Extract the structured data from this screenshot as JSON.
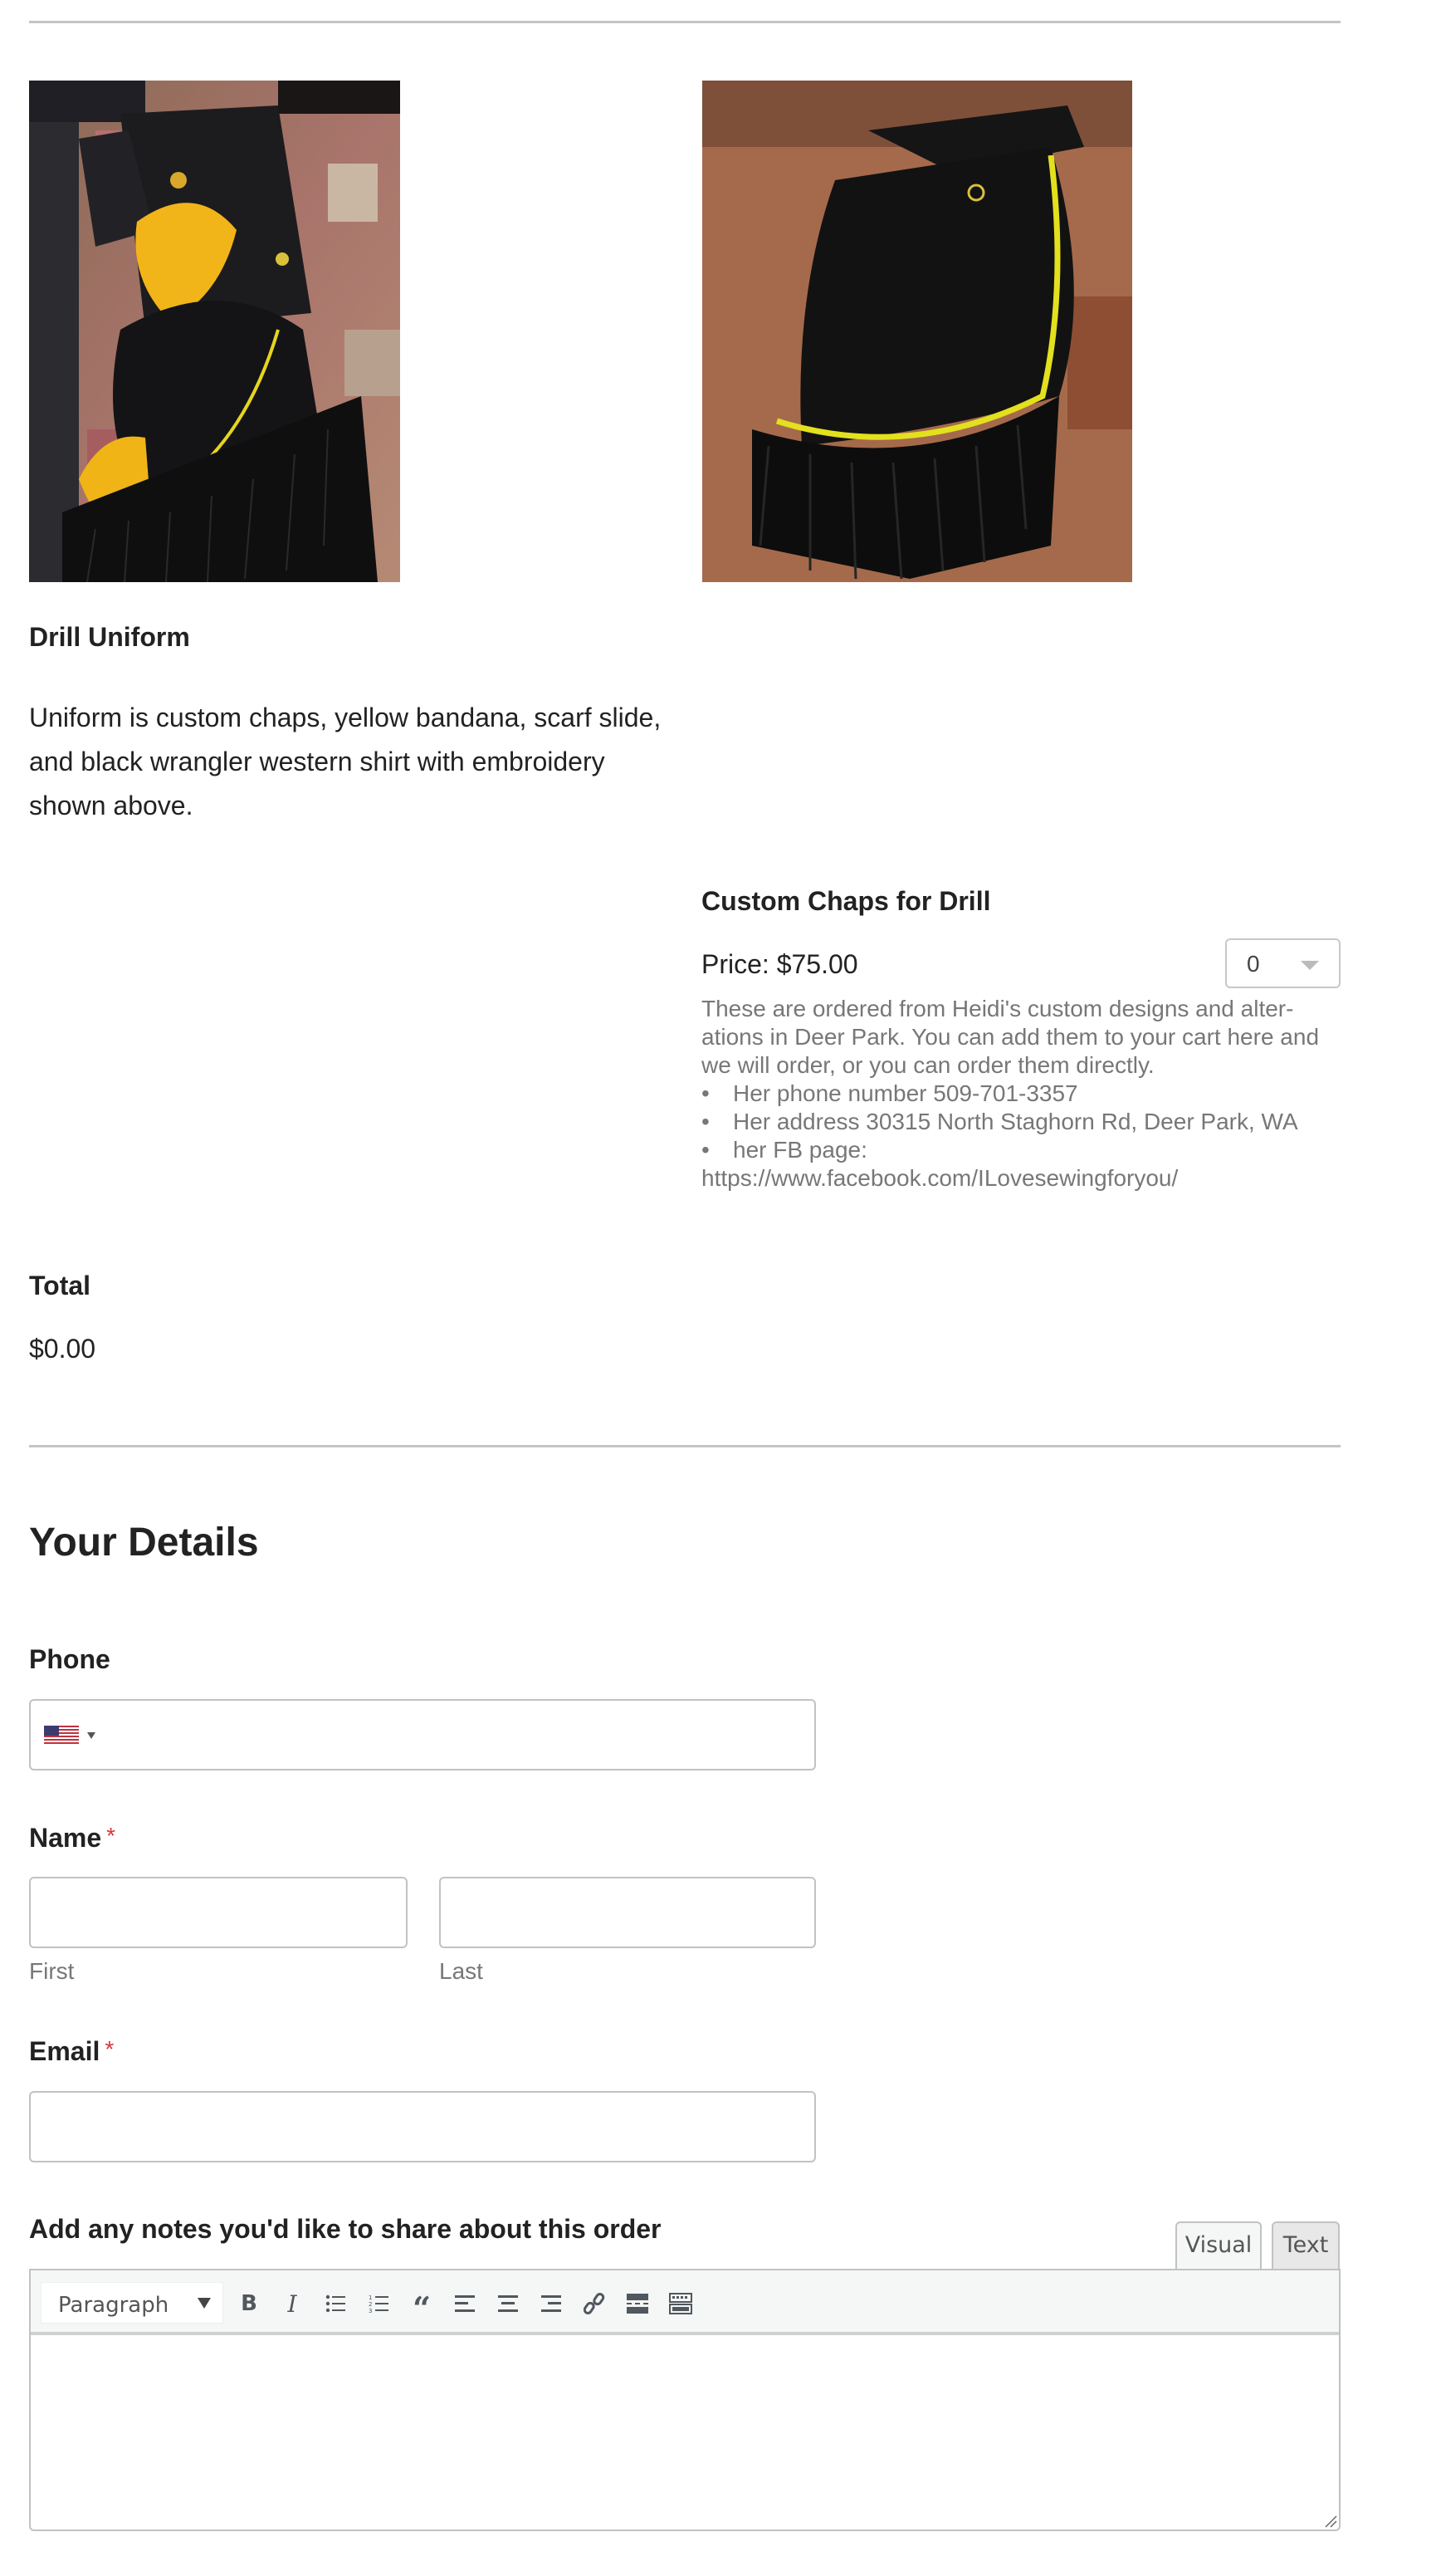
{
  "products": [
    {
      "title": "Drill Uniform",
      "image_alt": "Drill uniform: black western shirt, yellow bandana and black fringed chaps",
      "description": "Uniform is custom chaps, yellow bandana, scarf slide, and black wrangler western shirt with embroidery shown above."
    },
    {
      "title": "Custom Chaps for Drill",
      "image_alt": "Black fringed chaps with yellow piping",
      "price_label": "Price: $75.00",
      "quantity_selected": "0",
      "description": "These are ordered from Heidi's custom designs and alter-ations in Deer Park. You can add them to your cart here and we will order, or you can order them directly.",
      "bullets": [
        "Her phone number 509-701-3357",
        "Her address 30315 North Staghorn Rd, Deer Park, WA",
        "her FB page:"
      ],
      "fb_url": "https://www.facebook.com/ILovesewingforyou/"
    }
  ],
  "total": {
    "label": "Total",
    "value": "$0.00"
  },
  "details": {
    "heading": "Your Details",
    "phone": {
      "label": "Phone",
      "country": "US",
      "value": ""
    },
    "name": {
      "label": "Name",
      "required_mark": "*",
      "first_sublabel": "First",
      "last_sublabel": "Last",
      "first_value": "",
      "last_value": ""
    },
    "email": {
      "label": "Email",
      "required_mark": "*",
      "value": ""
    },
    "notes": {
      "label": "Add any notes you'd like to share about this order",
      "tabs": [
        "Visual",
        "Text"
      ],
      "active_tab": "Visual",
      "format_select": "Paragraph",
      "toolbar_icons": [
        "bold-icon",
        "italic-icon",
        "bulleted-list-icon",
        "numbered-list-icon",
        "blockquote-icon",
        "align-left-icon",
        "align-center-icon",
        "align-right-icon",
        "link-icon",
        "read-more-icon",
        "toolbar-toggle-icon"
      ],
      "value": ""
    }
  },
  "colors": {
    "required": "#d63638",
    "rule": "#c4c4c4",
    "muted_text": "#777777"
  }
}
